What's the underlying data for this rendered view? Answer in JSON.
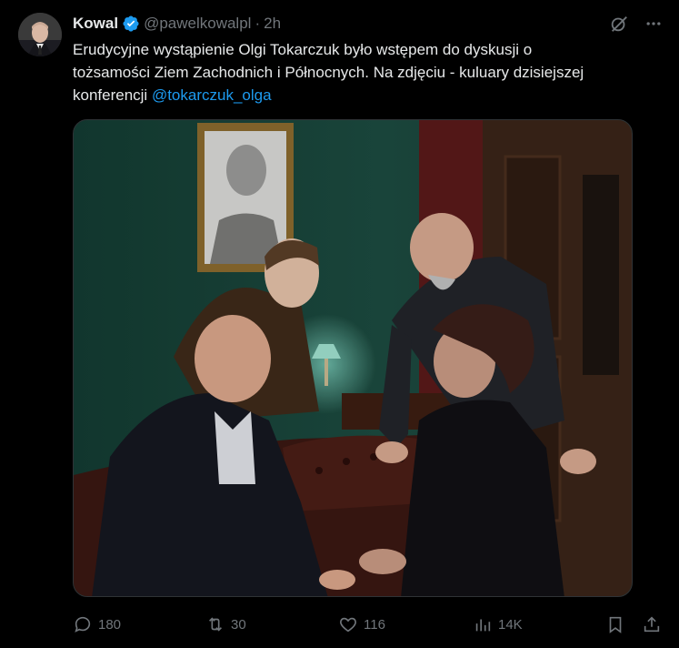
{
  "author": {
    "name": "Kowal",
    "handle": "@pawelkowalpl",
    "separator": "·",
    "time": "2h"
  },
  "tweet": {
    "text_line1": "Erudycyjne wystąpienie Olgi Tokarczuk było wstępem do dyskusji o",
    "text_line2": "tożsamości Ziem Zachodnich i Północnych. Na zdjęciu - kuluary dzisiejszej",
    "text_line3": "konferencji ",
    "mention": "@tokarczuk_olga"
  },
  "header_icons": [
    "grok-icon",
    "more-icon"
  ],
  "stats": {
    "replies": "180",
    "reposts": "30",
    "likes": "116",
    "views": "14K"
  },
  "colors": {
    "background": "#000000",
    "text": "#e7e9ea",
    "muted": "#71767b",
    "accent": "#1d9bf0"
  }
}
